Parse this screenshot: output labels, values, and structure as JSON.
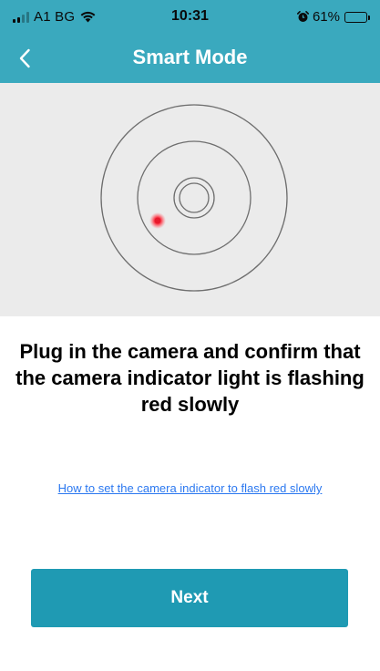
{
  "status_bar": {
    "carrier": "A1 BG",
    "time": "10:31",
    "battery": "61%",
    "battery_level": 0.61,
    "icons": [
      "signal-icon",
      "wifi-icon",
      "alarm-icon",
      "battery-icon"
    ]
  },
  "nav": {
    "title": "Smart Mode",
    "back_icon": "chevron-left-icon"
  },
  "illustration": {
    "indicator_color": "#e8192c"
  },
  "content": {
    "instruction": "Plug in the camera and confirm that the camera indicator light is flashing red slowly",
    "help_link": "How to set the camera indicator to flash red slowly"
  },
  "actions": {
    "next_label": "Next"
  },
  "colors": {
    "header": "#3aa9be",
    "button": "#1f9ab3",
    "link": "#2b78f0"
  }
}
